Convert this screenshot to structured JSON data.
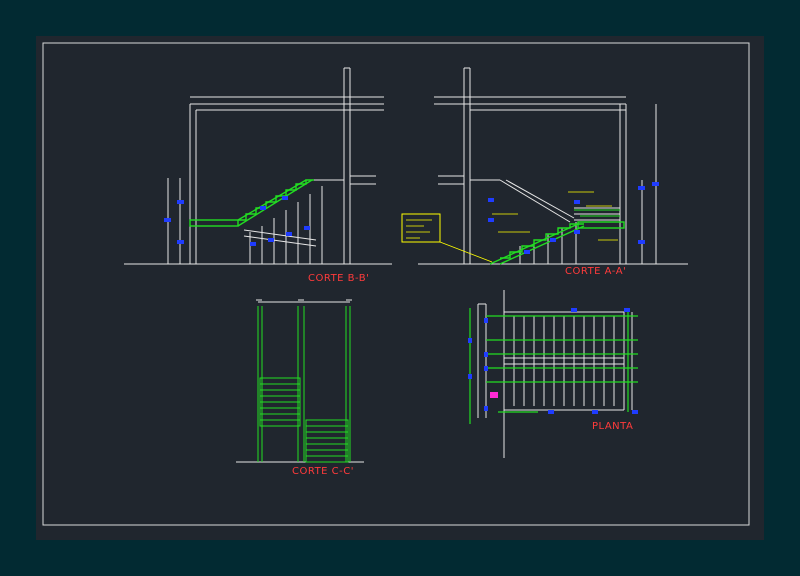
{
  "drawing": {
    "labels": {
      "section_bb": "CORTE B-B'",
      "section_aa": "CORTE A-A'",
      "section_cc": "CORTE C-C'",
      "plan": "PLANTA"
    }
  },
  "colors": {
    "canvas_background": "#022a32",
    "sheet_background": "#20262e",
    "frame": "#d9d9d9",
    "structure": "#e6e6e6",
    "stair": "#22dd22",
    "dimension_marker": "#1f3cff",
    "note": "#ffff00",
    "label": "#ff3b3b",
    "callout": "#ff2ad4"
  }
}
